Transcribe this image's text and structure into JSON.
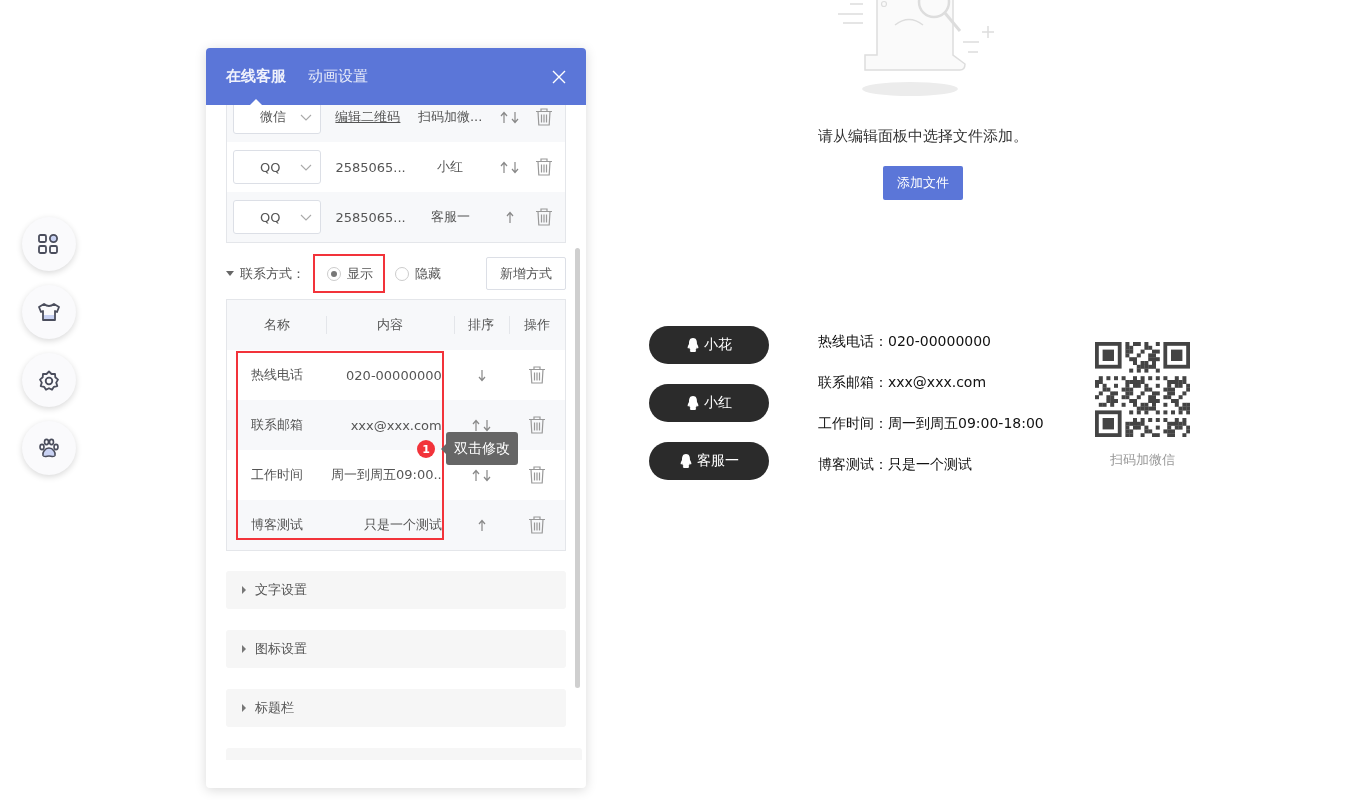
{
  "rail": [
    {
      "kind": "grid"
    },
    {
      "kind": "shirt"
    },
    {
      "kind": "gear"
    },
    {
      "kind": "paw"
    }
  ],
  "panel": {
    "tabs": [
      {
        "label": "在线客服",
        "selected": true
      },
      {
        "label": "动画设置",
        "selected": false
      }
    ],
    "services": [
      {
        "type": "微信",
        "account": "编辑二维码",
        "account_link": true,
        "name": "扫码加微...",
        "up": true,
        "down": true
      },
      {
        "type": "QQ",
        "account": "2585065...",
        "account_link": false,
        "name": "小红",
        "up": true,
        "down": true
      },
      {
        "type": "QQ",
        "account": "2585065...",
        "account_link": false,
        "name": "客服一",
        "up": true,
        "down": false
      }
    ],
    "contact_mode": {
      "label": "联系方式：",
      "options": [
        {
          "label": "显示",
          "selected": true,
          "highlighted": true
        },
        {
          "label": "隐藏",
          "selected": false,
          "highlighted": false
        }
      ],
      "add_button": "新增方式"
    },
    "contacts": {
      "columns": [
        "名称",
        "内容",
        "排序",
        "操作"
      ],
      "highlighted": true,
      "rows": [
        {
          "name": "热线电话",
          "content": "020-00000000",
          "up": false,
          "down": true
        },
        {
          "name": "联系邮箱",
          "content": "xxx@xxx.com",
          "up": true,
          "down": true
        },
        {
          "name": "工作时间",
          "content": "周一到周五09:00..",
          "up": true,
          "down": true
        },
        {
          "name": "博客测试",
          "content": "只是一个测试",
          "up": true,
          "down": false
        }
      ],
      "badge": "1",
      "tooltip": "双击修改"
    },
    "sections": [
      {
        "label": "文字设置",
        "expanded": false
      },
      {
        "label": "图标设置",
        "expanded": false
      },
      {
        "label": "标题栏",
        "expanded": false
      }
    ],
    "more_sections_below": true
  },
  "empty_state": {
    "message": "请从编辑面板中选择文件添加。",
    "button": "添加文件"
  },
  "preview": {
    "agents": [
      "小花",
      "小红",
      "客服一"
    ],
    "contacts": [
      "热线电话：020-00000000",
      "联系邮箱：xxx@xxx.com",
      "工作时间：周一到周五09:00-18:00",
      "博客测试：只是一个测试"
    ],
    "qr_caption": "扫码加微信"
  }
}
